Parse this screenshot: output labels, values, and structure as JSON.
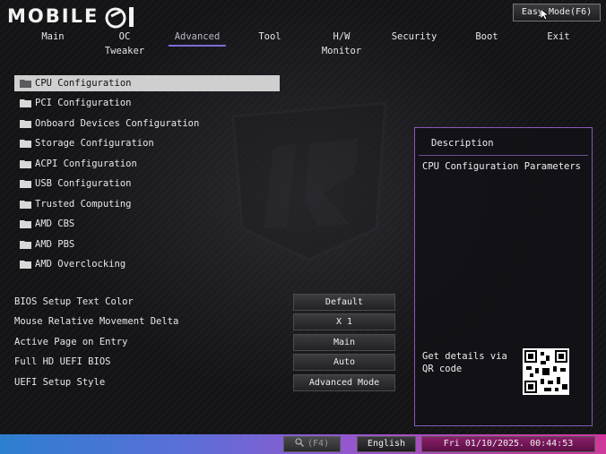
{
  "header": {
    "logo_text": "MOBILE",
    "easy_mode_label": "Easy Mode(F6)"
  },
  "tabs": [
    {
      "label": "Main"
    },
    {
      "label": "OC Tweaker"
    },
    {
      "label": "Advanced",
      "active": true
    },
    {
      "label": "Tool"
    },
    {
      "label": "H/W Monitor"
    },
    {
      "label": "Security"
    },
    {
      "label": "Boot"
    },
    {
      "label": "Exit"
    }
  ],
  "menu": {
    "items": [
      {
        "label": "CPU Configuration",
        "icon": "folder-icon",
        "selected": true
      },
      {
        "label": "PCI Configuration",
        "icon": "folder-icon"
      },
      {
        "label": "Onboard Devices Configuration",
        "icon": "folder-icon"
      },
      {
        "label": "Storage Configuration",
        "icon": "folder-icon"
      },
      {
        "label": "ACPI Configuration",
        "icon": "folder-icon"
      },
      {
        "label": "USB Configuration",
        "icon": "folder-icon"
      },
      {
        "label": "Trusted Computing",
        "icon": "folder-icon"
      },
      {
        "label": "AMD CBS",
        "icon": "folder-icon"
      },
      {
        "label": "AMD PBS",
        "icon": "folder-icon"
      },
      {
        "label": "AMD Overclocking",
        "icon": "folder-icon"
      }
    ]
  },
  "settings": [
    {
      "label": "BIOS Setup Text Color",
      "value": "Default"
    },
    {
      "label": "Mouse Relative Movement Delta",
      "value": "X 1"
    },
    {
      "label": "Active Page on Entry",
      "value": "Main"
    },
    {
      "label": "Full HD UEFI BIOS",
      "value": "Auto"
    },
    {
      "label": "UEFI Setup Style",
      "value": "Advanced Mode"
    }
  ],
  "description": {
    "title": "Description",
    "text": "CPU Configuration Parameters",
    "qr_text": "Get details via QR code"
  },
  "footer": {
    "search_label": "(F4)",
    "language": "English",
    "datetime": "Fri 01/10/2025. 00:44:53"
  },
  "colors": {
    "accent": "#7b6dd8",
    "panel_border": "#8b59b5",
    "footer_start": "#2d7fd0",
    "footer_end": "#d0389a"
  }
}
